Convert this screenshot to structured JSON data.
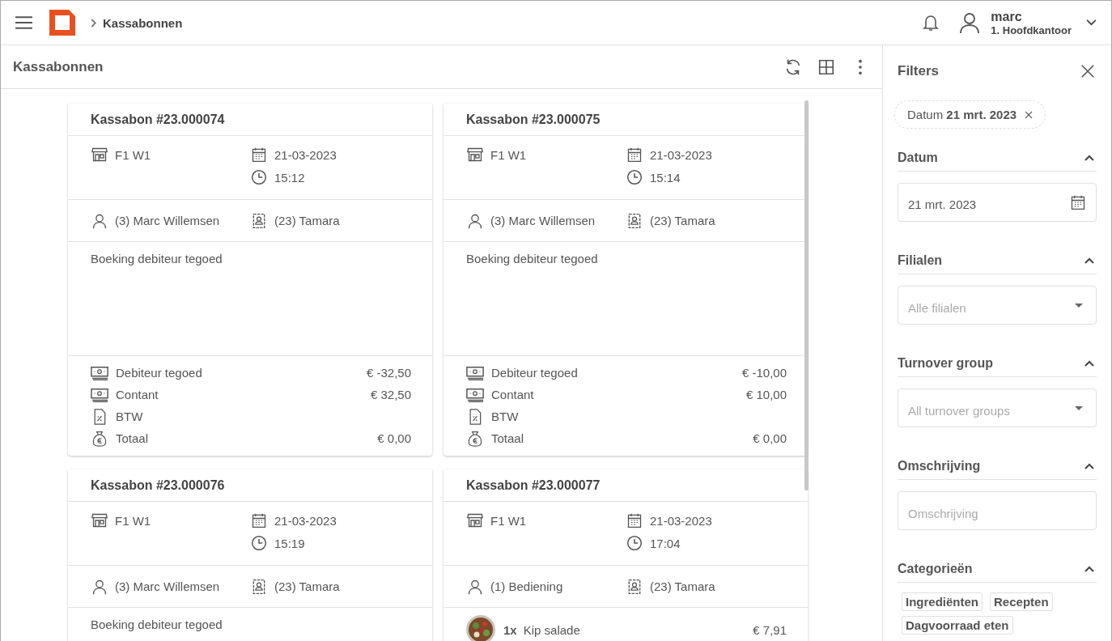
{
  "header": {
    "breadcrumb": "Kassabonnen",
    "user": {
      "name": "marc",
      "location": "1. Hoofdkantoor"
    }
  },
  "page": {
    "title": "Kassabonnen"
  },
  "receipts": [
    {
      "title": "Kassabon #23.000074",
      "location": "F1 W1",
      "date": "21-03-2023",
      "time": "15:12",
      "employee": "(3) Marc Willemsen",
      "customer": "(23) Tamara",
      "description": "Boeking debiteur tegoed",
      "payments": [
        {
          "kind": "money",
          "label": "Debiteur tegoed",
          "amount": "€ -32,50"
        },
        {
          "kind": "money",
          "label": "Contant",
          "amount": "€ 32,50"
        },
        {
          "kind": "tax",
          "label": "BTW"
        },
        {
          "kind": "total",
          "label": "Totaal",
          "amount": "€ 0,00"
        }
      ]
    },
    {
      "title": "Kassabon #23.000075",
      "location": "F1 W1",
      "date": "21-03-2023",
      "time": "15:14",
      "employee": "(3) Marc Willemsen",
      "customer": "(23) Tamara",
      "description": "Boeking debiteur tegoed",
      "payments": [
        {
          "kind": "money",
          "label": "Debiteur tegoed",
          "amount": "€ -10,00"
        },
        {
          "kind": "money",
          "label": "Contant",
          "amount": "€ 10,00"
        },
        {
          "kind": "tax",
          "label": "BTW"
        },
        {
          "kind": "total",
          "label": "Totaal",
          "amount": "€ 0,00"
        }
      ]
    },
    {
      "title": "Kassabon #23.000076",
      "location": "F1 W1",
      "date": "21-03-2023",
      "time": "15:19",
      "employee": "(3) Marc Willemsen",
      "customer": "(23) Tamara",
      "description": "Boeking debiteur tegoed"
    },
    {
      "title": "Kassabon #23.000077",
      "location": "F1 W1",
      "date": "21-03-2023",
      "time": "17:04",
      "employee": "(1) Bediening",
      "customer": "(23) Tamara",
      "items": [
        {
          "quantity": "1x",
          "name": "Kip salade",
          "price": "€ 7,91",
          "kind": "picture"
        }
      ]
    }
  ],
  "filters": {
    "title": "Filters",
    "active_chips": [
      "Datum **21 mrt. 2023**"
    ],
    "sections": [
      {
        "title": "Datum",
        "expanded": true,
        "kind": "date",
        "value": "21 mrt. 2023"
      },
      {
        "title": "Filialen",
        "expanded": true,
        "kind": "select",
        "placeholder": "Alle filialen"
      },
      {
        "title": "Turnover group",
        "expanded": true,
        "kind": "select",
        "placeholder": "All turnover groups"
      },
      {
        "title": "Omschrijving",
        "expanded": true,
        "kind": "text",
        "placeholder": "Omschrijving"
      },
      {
        "title": "Categorieën",
        "expanded": true,
        "kind": "chips",
        "options": [
          "Ingrediënten",
          "Recepten",
          "Dagvoorraad eten"
        ]
      }
    ]
  }
}
